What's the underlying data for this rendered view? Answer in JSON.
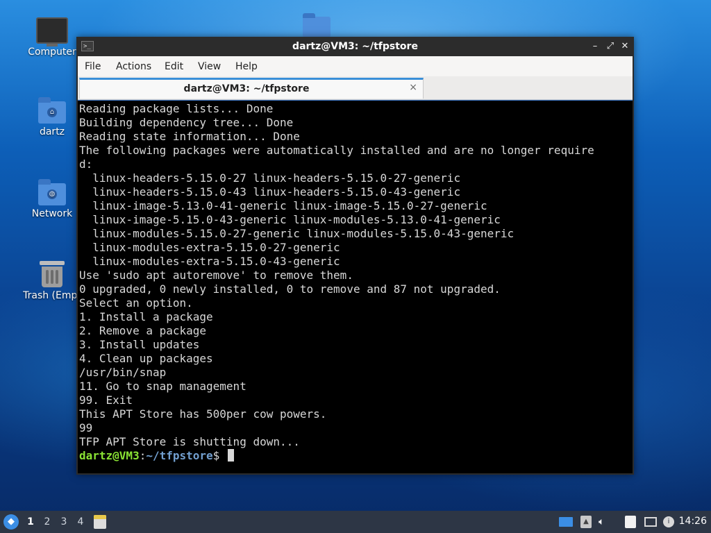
{
  "desktop": {
    "icons": [
      {
        "label": "Computer",
        "icon": "computer-icon"
      },
      {
        "label": "dartz",
        "icon": "home-folder-icon"
      },
      {
        "label": "Network",
        "icon": "network-folder-icon"
      },
      {
        "label": "Trash (Empt",
        "icon": "trash-icon"
      }
    ]
  },
  "window": {
    "title": "dartz@VM3: ~/tfpstore",
    "menu": [
      "File",
      "Actions",
      "Edit",
      "View",
      "Help"
    ],
    "tab": {
      "label": "dartz@VM3: ~/tfpstore",
      "close": "×"
    },
    "buttons": {
      "minimize": "–",
      "maximize": "⤢",
      "close": "✕"
    }
  },
  "terminal": {
    "output": "Reading package lists... Done\nBuilding dependency tree... Done\nReading state information... Done\nThe following packages were automatically installed and are no longer require\nd:\n  linux-headers-5.15.0-27 linux-headers-5.15.0-27-generic\n  linux-headers-5.15.0-43 linux-headers-5.15.0-43-generic\n  linux-image-5.13.0-41-generic linux-image-5.15.0-27-generic\n  linux-image-5.15.0-43-generic linux-modules-5.13.0-41-generic\n  linux-modules-5.15.0-27-generic linux-modules-5.15.0-43-generic\n  linux-modules-extra-5.15.0-27-generic\n  linux-modules-extra-5.15.0-43-generic\nUse 'sudo apt autoremove' to remove them.\n0 upgraded, 0 newly installed, 0 to remove and 87 not upgraded.\nSelect an option.\n1. Install a package\n2. Remove a package\n3. Install updates\n4. Clean up packages\n/usr/bin/snap\n11. Go to snap management\n99. Exit\nThis APT Store has 500per cow powers.\n99\nTFP APT Store is shutting down...",
    "prompt_user": "dartz@VM3",
    "prompt_colon": ":",
    "prompt_path": "~/tfpstore",
    "prompt_symbol": "$"
  },
  "taskbar": {
    "workspaces": [
      "1",
      "2",
      "3",
      "4"
    ],
    "active_workspace": "1",
    "clock": "14:26",
    "tray_icons": [
      "show-desktop-icon",
      "notes-icon",
      "volume-icon",
      "clipboard-icon",
      "network-icon",
      "updates-icon"
    ]
  },
  "colors": {
    "prompt_user": "#8ae234",
    "prompt_path": "#729fcf",
    "accent": "#3a8fd8"
  }
}
